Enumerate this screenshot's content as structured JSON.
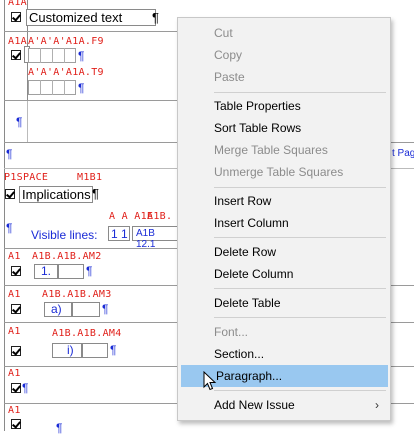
{
  "document": {
    "row1_label": "A1A",
    "row1_text": "Customized text",
    "row2_label": "A1A",
    "row2_field1": "A'A'A'A1A.F9",
    "row2_field2": "A'A'A'A1A.T9",
    "space_label": "P1SPACE",
    "m1b1_label": "M1B1",
    "implications_text": "Implications",
    "aaa_label": "A A A1E",
    "a1b_label": "A1B.",
    "visible_lines_text": "Visible lines:",
    "visible_lines_values": "1 1",
    "a1b_value": "A1B 12.1",
    "am2_label": "A1B.A1B.AM2",
    "am2_value": "1.",
    "am3_label": "A1B.A1B.AM3",
    "am3_value": "a)",
    "am4_label": "A1B.A1B.AM4",
    "am4_value": "i)",
    "left_labels": [
      "A1",
      "A1",
      "A1",
      "A1",
      "A1",
      "A1"
    ],
    "pilcrow": "¶",
    "right_edge_text": "t Pag"
  },
  "context_menu": {
    "items": [
      {
        "label": "Cut",
        "enabled": false
      },
      {
        "label": "Copy",
        "enabled": false
      },
      {
        "label": "Paste",
        "enabled": false
      },
      {
        "label": "Table Properties",
        "enabled": true
      },
      {
        "label": "Sort Table Rows",
        "enabled": true
      },
      {
        "label": "Merge Table Squares",
        "enabled": false
      },
      {
        "label": "Unmerge Table Squares",
        "enabled": false
      },
      {
        "label": "Insert Row",
        "enabled": true
      },
      {
        "label": "Insert Column",
        "enabled": true
      },
      {
        "label": "Delete Row",
        "enabled": true
      },
      {
        "label": "Delete Column",
        "enabled": true
      },
      {
        "label": "Delete Table",
        "enabled": true
      },
      {
        "label": "Font...",
        "enabled": false
      },
      {
        "label": "Section...",
        "enabled": true
      },
      {
        "label": "Paragraph...",
        "enabled": true,
        "highlighted": true
      },
      {
        "label": "Add New Issue",
        "enabled": true,
        "submenu": true
      }
    ],
    "submenu_arrow": "›",
    "highlight_color": "#99c8f0"
  }
}
